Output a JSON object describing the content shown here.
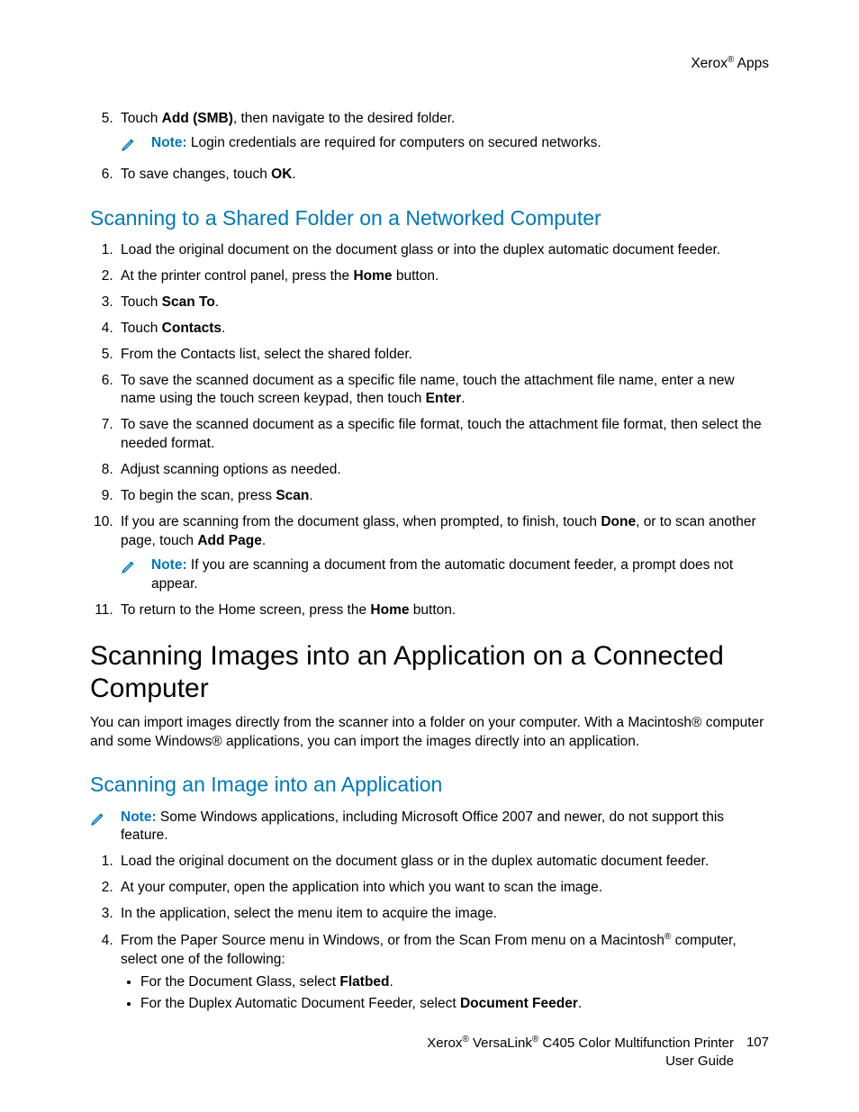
{
  "header": {
    "brand": "Xerox",
    "section": "Apps"
  },
  "intro_steps_start": 5,
  "intro_steps": [
    {
      "pre": "Touch ",
      "bold": "Add (SMB)",
      "post": ", then navigate to the desired folder."
    },
    {
      "pre": "To save changes, touch ",
      "bold": "OK",
      "post": "."
    }
  ],
  "intro_note": {
    "label": "Note:",
    "text": "Login credentials are required for computers on secured networks."
  },
  "h2a": "Scanning to a Shared Folder on a Networked Computer",
  "sharedSteps": [
    "Load the original document on the document glass or into the duplex automatic document feeder.",
    {
      "pre": "At the printer control panel, press the ",
      "bold": "Home",
      "post": " button."
    },
    {
      "pre": "Touch ",
      "bold": "Scan To",
      "post": "."
    },
    {
      "pre": "Touch ",
      "bold": "Contacts",
      "post": "."
    },
    "From the Contacts list, select the shared folder.",
    {
      "pre": "To save the scanned document as a specific file name, touch the attachment file name, enter a new name using the touch screen keypad, then touch ",
      "bold": "Enter",
      "post": "."
    },
    "To save the scanned document as a specific file format, touch the attachment file format, then select the needed format.",
    "Adjust scanning options as needed.",
    {
      "pre": "To begin the scan, press ",
      "bold": "Scan",
      "post": "."
    },
    {
      "pre": "If you are scanning from the document glass, when prompted, to finish, touch ",
      "bold": "Done",
      "mid": ", or to scan another page, touch ",
      "bold2": "Add Page",
      "post": "."
    },
    {
      "pre": "To return to the Home screen, press the ",
      "bold": "Home",
      "post": " button."
    }
  ],
  "shared_note": {
    "label": "Note:",
    "text": "If you are scanning a document from the automatic document feeder, a prompt does not appear."
  },
  "h1": "Scanning Images into an Application on a Connected Computer",
  "h1_para": "You can import images directly from the scanner into a folder on your computer. With a Macintosh® computer and some Windows® applications, you can import the images directly into an application.",
  "h2b": "Scanning an Image into an Application",
  "app_note": {
    "label": "Note:",
    "text": "Some Windows applications, including Microsoft Office 2007 and newer, do not support this feature."
  },
  "appSteps": [
    "Load the original document on the document glass or in the duplex automatic document feeder.",
    "At your computer, open the application into which you want to scan the image.",
    "In the application, select the menu item to acquire the image.",
    {
      "pre": "From the Paper Source menu in Windows, or from the Scan From menu on a Macintosh",
      "reg": "®",
      "post": " computer, select one of the following:",
      "bullets": [
        {
          "pre": "For the Document Glass, select ",
          "bold": "Flatbed",
          "post": "."
        },
        {
          "pre": "For the Duplex Automatic Document Feeder, select ",
          "bold": "Document Feeder",
          "post": "."
        }
      ]
    }
  ],
  "footer": {
    "line1a": "Xerox",
    "line1b": "VersaLink",
    "line1c": "C405 Color Multifunction Printer",
    "line2": "User Guide",
    "page": "107"
  }
}
